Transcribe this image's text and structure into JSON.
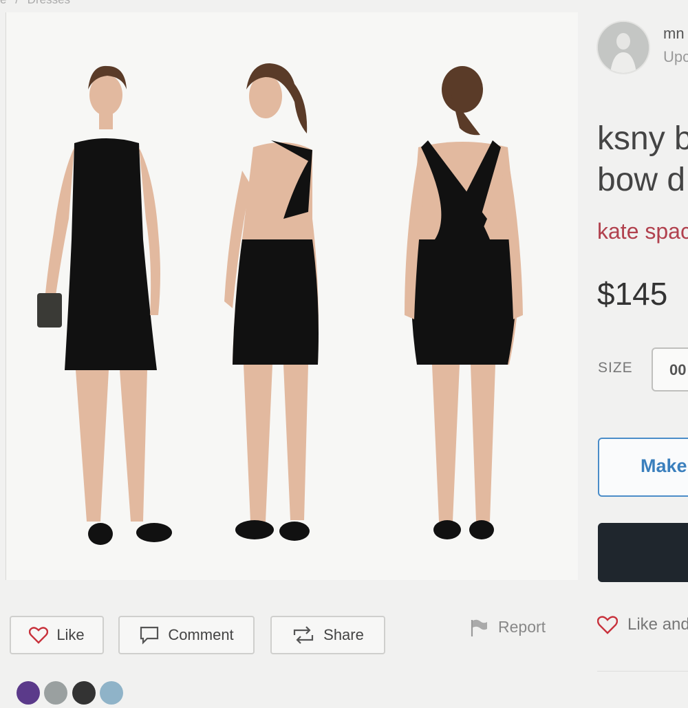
{
  "breadcrumb": {
    "items": [
      "e",
      "/",
      "Dresses"
    ]
  },
  "seller": {
    "name": "mn",
    "sub": "Upc"
  },
  "listing": {
    "title": "ksny b\nbow d",
    "brand": "kate spac",
    "price": "$145"
  },
  "size": {
    "label": "SIZE",
    "value": "00"
  },
  "buttons": {
    "make_offer": "Make",
    "like": "Like",
    "comment": "Comment",
    "share": "Share",
    "report": "Report"
  },
  "like_and": "Like and",
  "colors": {
    "brand": "#b1414e",
    "offer_border": "#4a8cc8",
    "buy_bg": "#1f262d",
    "heart": "#c8323c"
  }
}
